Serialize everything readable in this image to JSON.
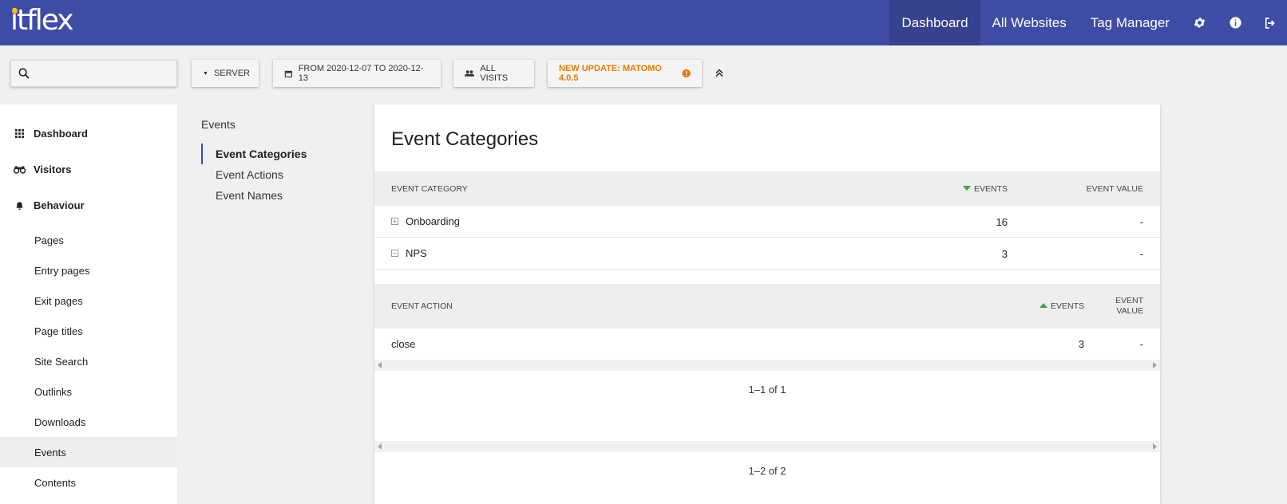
{
  "app": {
    "logo_text": "itflex"
  },
  "topnav": {
    "items": [
      {
        "label": "Dashboard",
        "active": true
      },
      {
        "label": "All Websites"
      },
      {
        "label": "Tag Manager"
      }
    ],
    "icons": [
      "gear-icon",
      "info-icon",
      "logout-icon"
    ]
  },
  "toolbar": {
    "search_placeholder": "",
    "segment_label": "SERVER",
    "date_label": "FROM 2020-12-07 TO 2020-12-13",
    "visits_label": "ALL VISITS",
    "update_label": "NEW UPDATE: MATOMO 4.0.5",
    "accent_color": "#e67c00"
  },
  "sidebar": {
    "main": [
      {
        "label": "Dashboard",
        "icon": "grid-icon"
      },
      {
        "label": "Visitors",
        "icon": "binoculars-icon"
      },
      {
        "label": "Behaviour",
        "icon": "bell-icon"
      }
    ],
    "sub": [
      {
        "label": "Pages"
      },
      {
        "label": "Entry pages"
      },
      {
        "label": "Exit pages"
      },
      {
        "label": "Page titles"
      },
      {
        "label": "Site Search"
      },
      {
        "label": "Outlinks"
      },
      {
        "label": "Downloads"
      },
      {
        "label": "Events",
        "active": true
      },
      {
        "label": "Contents"
      }
    ]
  },
  "subnav": {
    "title": "Events",
    "items": [
      {
        "label": "Event Categories",
        "active": true
      },
      {
        "label": "Event Actions"
      },
      {
        "label": "Event Names"
      }
    ]
  },
  "card": {
    "title": "Event Categories",
    "table": {
      "headers": {
        "category": "EVENT CATEGORY",
        "events": "EVENTS",
        "value": "EVENT VALUE"
      },
      "rows": [
        {
          "label": "Onboarding",
          "events": "16",
          "value": "-",
          "expander": "+"
        },
        {
          "label": "NPS",
          "events": "3",
          "value": "-",
          "expander": "−"
        }
      ]
    },
    "subtable": {
      "headers": {
        "action": "EVENT ACTION",
        "events": "EVENTS",
        "value_line1": "EVENT",
        "value_line2": "VALUE"
      },
      "rows": [
        {
          "label": "close",
          "events": "3",
          "value": "-"
        }
      ],
      "pager": "1–1 of 1"
    },
    "pager": "1–2 of 2"
  },
  "colors": {
    "topbar": "#3f4ca5",
    "sort_arrow": "#43a047"
  }
}
